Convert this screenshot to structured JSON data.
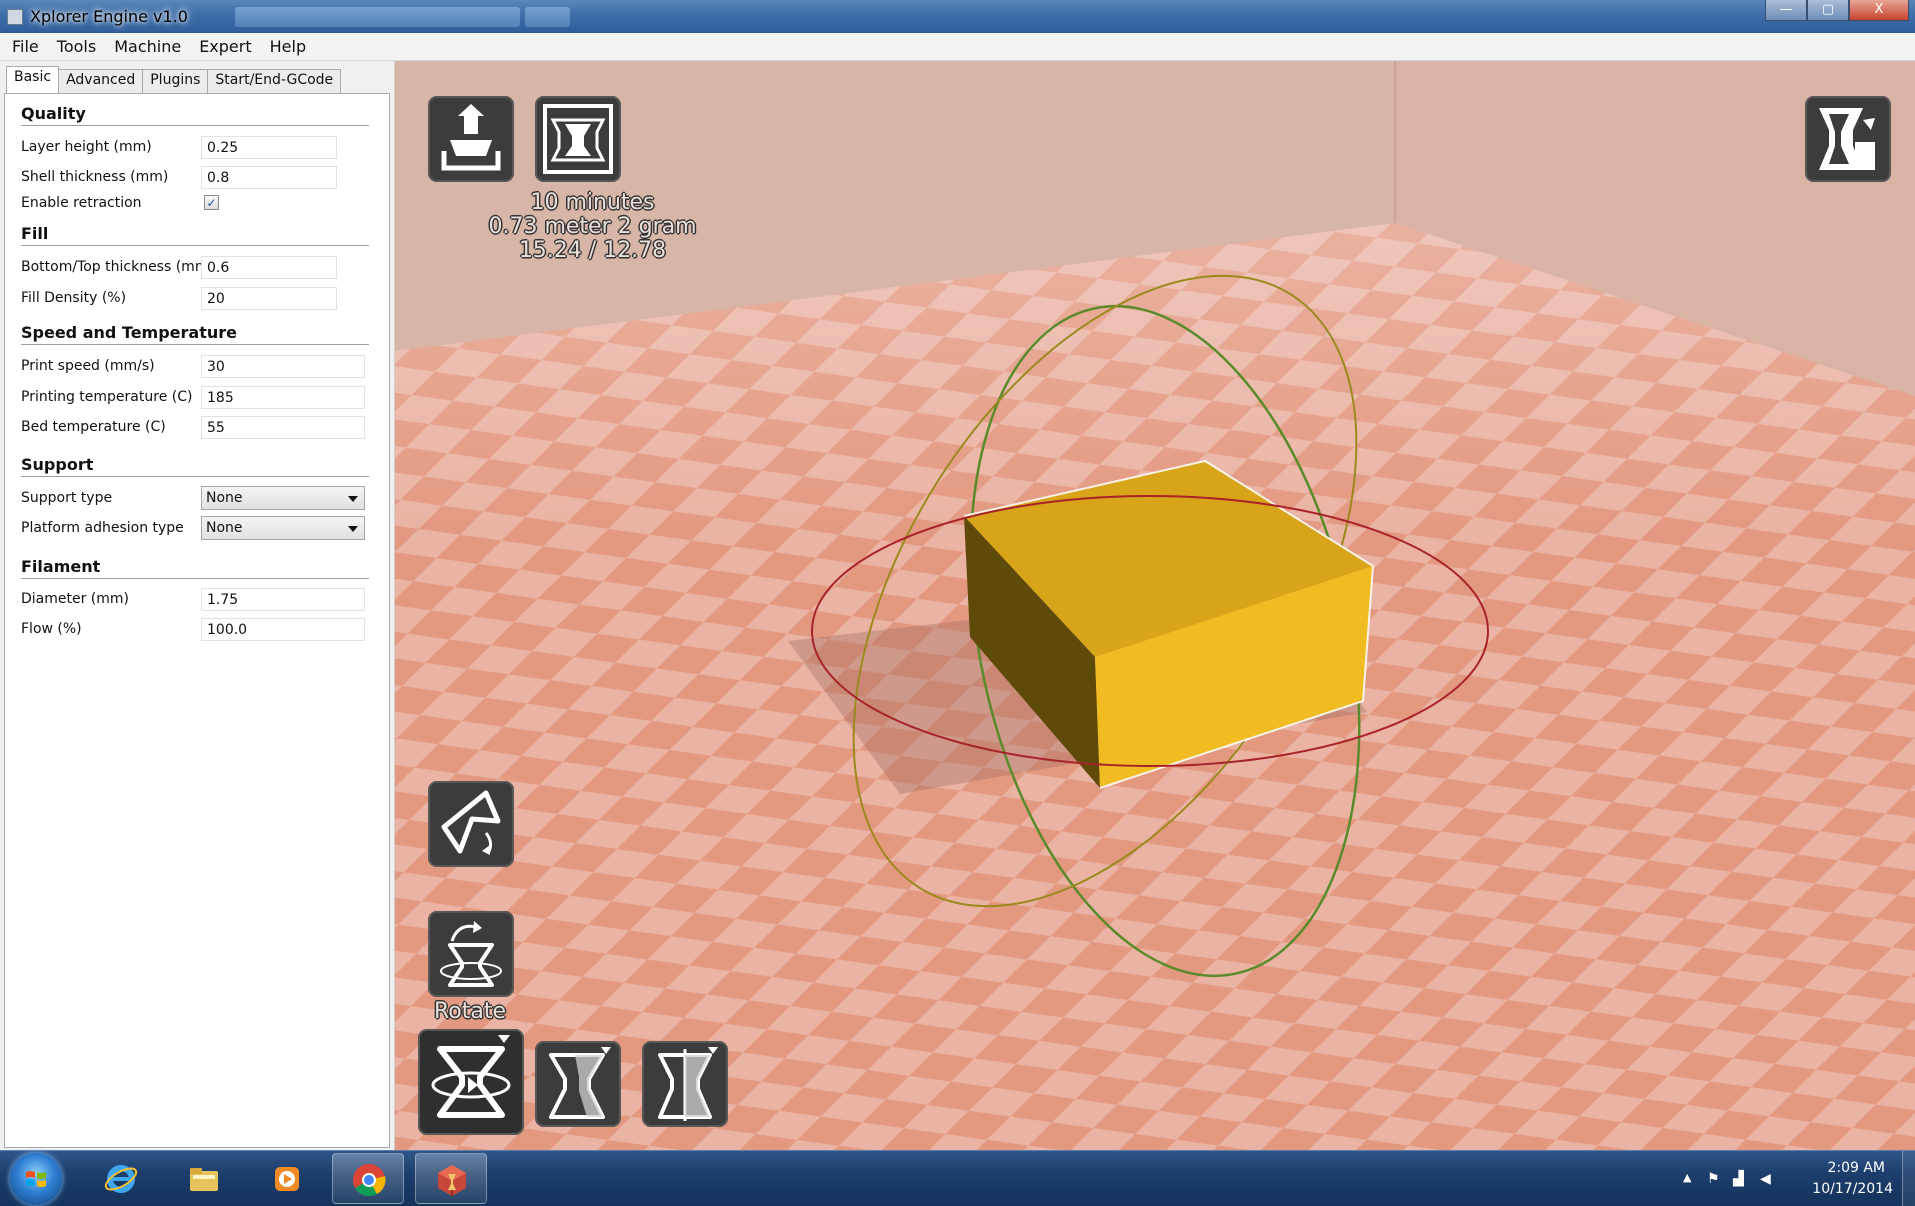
{
  "window": {
    "title": "Xplorer Engine v1.0",
    "controls": {
      "minimize": "—",
      "maximize": "▢",
      "close": "X"
    }
  },
  "menu": [
    "File",
    "Tools",
    "Machine",
    "Expert",
    "Help"
  ],
  "tabs": [
    "Basic",
    "Advanced",
    "Plugins",
    "Start/End-GCode"
  ],
  "settings": {
    "quality": {
      "title": "Quality",
      "layer_height_label": "Layer height (mm)",
      "layer_height": "0.25",
      "shell_thickness_label": "Shell thickness (mm)",
      "shell_thickness": "0.8",
      "retraction_label": "Enable retraction",
      "retraction_checked": true
    },
    "fill": {
      "title": "Fill",
      "bottom_top_label": "Bottom/Top thickness (mm)",
      "bottom_top": "0.6",
      "density_label": "Fill Density (%)",
      "density": "20"
    },
    "speed": {
      "title": "Speed and Temperature",
      "print_speed_label": "Print speed (mm/s)",
      "print_speed": "30",
      "print_temp_label": "Printing temperature (C)",
      "print_temp": "185",
      "bed_temp_label": "Bed temperature (C)",
      "bed_temp": "55"
    },
    "support": {
      "title": "Support",
      "support_type_label": "Support type",
      "support_type": "None",
      "adhesion_label": "Platform adhesion type",
      "adhesion": "None"
    },
    "filament": {
      "title": "Filament",
      "diameter_label": "Diameter (mm)",
      "diameter": "1.75",
      "flow_label": "Flow (%)",
      "flow": "100.0"
    }
  },
  "viewport": {
    "print_time": "10 minutes",
    "material": "0.73 meter 2 gram",
    "dims": "15.24 / 12.78",
    "rotate_label": "Rotate",
    "icons": [
      "load-model-icon",
      "save-toolpath-icon",
      "view-mode-icon",
      "rotate-tool-icon",
      "scale-tool-icon",
      "mirror-tool-icon",
      "lay-flat-icon",
      "reset-rotation-icon"
    ]
  },
  "colors": {
    "floor_dark": "#e39880",
    "floor_light": "#eab3a3",
    "wall": "#d7b6a8",
    "model_top": "#d8a41a",
    "model_front": "#f0bc22",
    "model_side": "#5e4a09",
    "ring_red": "#a8232a",
    "ring_green": "#5a8a2a",
    "ring_olive": "#9a8a1e"
  },
  "taskbar": {
    "apps": [
      "internet-explorer-icon",
      "file-explorer-icon",
      "media-player-icon",
      "chrome-icon",
      "xplorer-engine-icon"
    ],
    "time": "2:09 AM",
    "date": "10/17/2014"
  }
}
